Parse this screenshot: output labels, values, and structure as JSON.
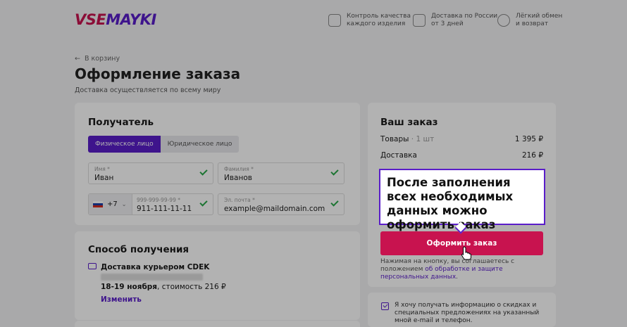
{
  "header": {
    "logo_part1": "VSE",
    "logo_part2": "MAYKI",
    "features": [
      {
        "icon": "tshirt-icon",
        "text": "Контроль качества\nкаждого изделия"
      },
      {
        "icon": "truck-icon",
        "text": "Доставка по России\nот 3 дней"
      },
      {
        "icon": "refresh-icon",
        "text": "Лёгкий обмен\nи возврат"
      }
    ]
  },
  "page": {
    "back_link": "В корзину",
    "title": "Оформление заказа",
    "subtitle": "Доставка осуществляется по всему миру"
  },
  "recipient": {
    "title": "Получатель",
    "tabs": [
      "Физическое лицо",
      "Юридическое лицо"
    ],
    "first_name_label": "Имя *",
    "first_name": "Иван",
    "last_name_label": "Фамилия *",
    "last_name": "Иванов",
    "phone_code": "+7",
    "phone_label": "999-999-99-99 *",
    "phone": "911-111-11-11",
    "email_label": "Эл. почта *",
    "email": "example@maildomain.com"
  },
  "delivery": {
    "title": "Способ получения",
    "method": "Доставка курьером CDEK",
    "date": "18-19 ноября",
    "cost_text": ", стоимость 216 ₽",
    "change": "Изменить"
  },
  "order": {
    "title": "Ваш заказ",
    "goods_label": "Товары",
    "goods_qty": "· 1 шт",
    "goods_price": "1 395 ₽",
    "delivery_label": "Доставка",
    "delivery_price": "216 ₽",
    "button": "Оформить заказ",
    "agree_text": "Нажимая на кнопку, вы соглашаетесь с положением ",
    "agree_link": "об обработке и защите персональных данных",
    "agree_end": "."
  },
  "consent": {
    "text": "Я хочу получать информацию о скидках и специальных предложениях на указанный мной e-mail и телефон."
  },
  "callout": {
    "text": "После заполнения всех необходимых данных можно оформить заказ"
  }
}
